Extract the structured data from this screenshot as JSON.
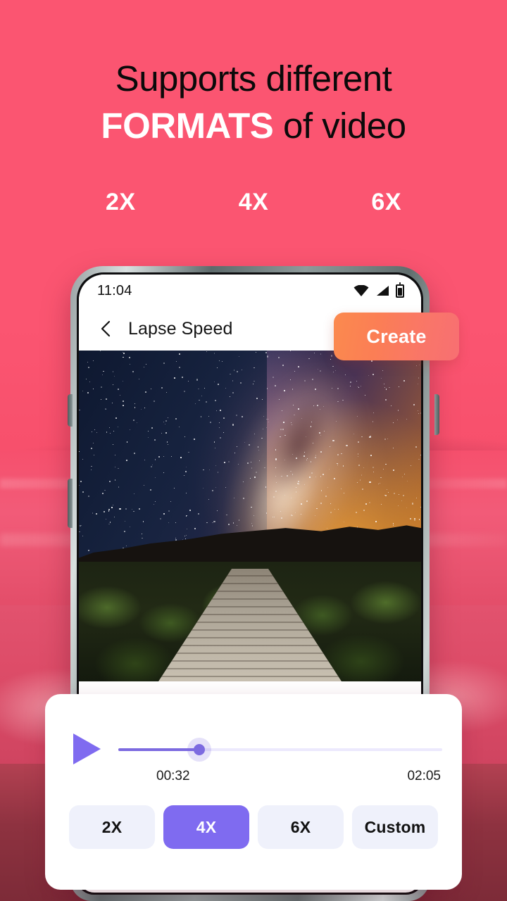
{
  "theme": {
    "background": "#fb5571",
    "accent_purple": "#7f6bf0",
    "create_gradient_from": "#fb8a4e",
    "create_gradient_to": "#f86f72"
  },
  "headline": {
    "line1": "Supports different",
    "line2_bold": "FORMATS",
    "line2_rest": " of video"
  },
  "speed_labels": [
    "2X",
    "4X",
    "6X"
  ],
  "phone": {
    "status_bar": {
      "time": "11:04",
      "icons": [
        "wifi-icon",
        "signal-icon",
        "battery-icon"
      ]
    },
    "appbar": {
      "back_icon": "back-chevron-icon",
      "title": "Lapse Speed",
      "create_label": "Create"
    },
    "video": {
      "description": "milky-way-night-sky-boardwalk"
    }
  },
  "controls": {
    "play_icon": "play-icon",
    "progress_percent": 25,
    "current_time": "00:32",
    "total_time": "02:05",
    "speed_options": [
      {
        "label": "2X",
        "selected": false
      },
      {
        "label": "4X",
        "selected": true
      },
      {
        "label": "6X",
        "selected": false
      },
      {
        "label": "Custom",
        "selected": false
      }
    ]
  }
}
